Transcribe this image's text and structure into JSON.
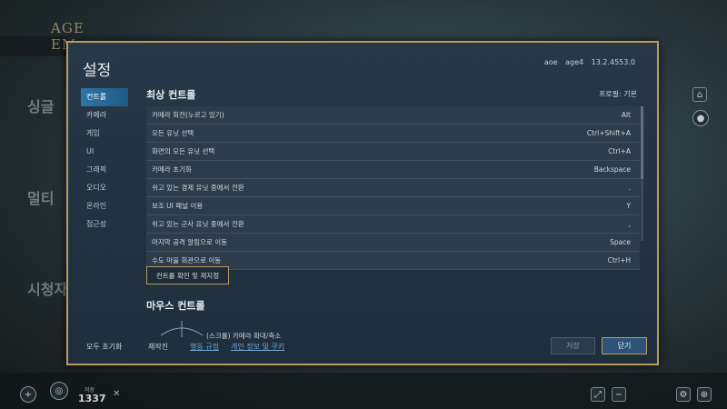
{
  "background": {
    "logo_line1": "AGE",
    "logo_line2": "EM",
    "menu_items": [
      "싱글",
      "멀티",
      "시청자"
    ],
    "counter_label": "저장",
    "counter_value": "1337",
    "close_glyph": "✕"
  },
  "dialog": {
    "title": "설정",
    "version": [
      "aoe",
      "age4",
      "13.2.4553.0"
    ]
  },
  "sidebar": {
    "items": [
      {
        "label": "컨트롤"
      },
      {
        "label": "카메라"
      },
      {
        "label": "게임"
      },
      {
        "label": "UI"
      },
      {
        "label": "그래픽"
      },
      {
        "label": "오디오"
      },
      {
        "label": "온라인"
      },
      {
        "label": "접근성"
      }
    ]
  },
  "controls": {
    "section_title": "최상 컨트롤",
    "profile": "프로필: 기본",
    "rows": [
      {
        "action": "카메라 회전(누르고 있기)",
        "key": "Alt"
      },
      {
        "action": "모든 유닛 선택",
        "key": "Ctrl+Shift+A"
      },
      {
        "action": "화면의 모든 유닛 선택",
        "key": "Ctrl+A"
      },
      {
        "action": "카메라 초기화",
        "key": "Backspace"
      },
      {
        "action": "쉬고 있는 경제 유닛 중에서 전환",
        "key": "."
      },
      {
        "action": "보조 UI 패널 이용",
        "key": "Y"
      },
      {
        "action": "쉬고 있는 군사 유닛 중에서 전환",
        "key": ","
      },
      {
        "action": "마지막 공격 알림으로 이동",
        "key": "Space"
      },
      {
        "action": "수도 마을 회관으로 이동",
        "key": "Ctrl+H"
      }
    ],
    "verify_button": "컨트롤 확인 및 재지정"
  },
  "mouse": {
    "section_title": "마우스 컨트롤",
    "caption": "(스크롤) 카메라 확대/축소"
  },
  "footer": {
    "reset_all": "모두 초기화",
    "credits": "제작진",
    "code_of_conduct": "행동 규정",
    "privacy": "개인 정보 및 쿠키",
    "save": "저장",
    "close": "닫기"
  }
}
